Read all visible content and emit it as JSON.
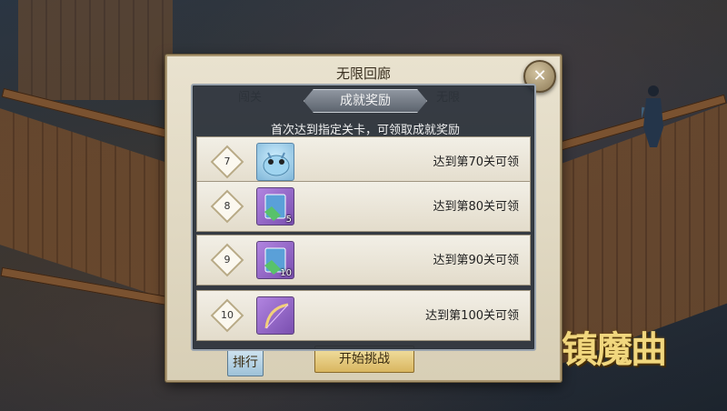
{
  "window": {
    "title": "无限回廊"
  },
  "background_tabs": {
    "left": "闯关",
    "right": "无限"
  },
  "overlay": {
    "tab_label": "成就奖励",
    "header": "首次达到指定关卡，可领取成就奖励",
    "rows": [
      {
        "level": "7",
        "item_icon": "dragon-pet-icon",
        "count": "",
        "text": "达到第70关可领"
      },
      {
        "level": "8",
        "item_icon": "green-gem-card-icon",
        "count": "5",
        "text": "达到第80关可领"
      },
      {
        "level": "9",
        "item_icon": "green-gem-card-icon",
        "count": "10",
        "text": "达到第90关可领"
      },
      {
        "level": "10",
        "item_icon": "bow-weapon-icon",
        "count": "",
        "text": "达到第100关可领"
      }
    ]
  },
  "buttons": {
    "rank": "排行",
    "start": "开始挑战",
    "close": "✕"
  },
  "logo": {
    "text": "镇魔曲"
  },
  "colors": {
    "panel_bg": "#e9e2cf",
    "overlay_bg": "#2c323c",
    "start_button": "#e6c774",
    "logo_gold": "#f1d77e"
  }
}
